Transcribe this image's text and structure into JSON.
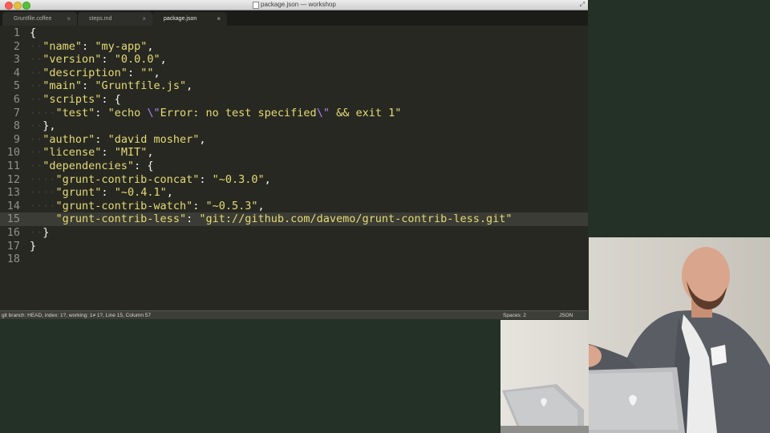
{
  "window": {
    "title": "package.json — workshop"
  },
  "tabs": [
    {
      "label": "Gruntfile.coffee",
      "active": false
    },
    {
      "label": "steps.md",
      "active": false
    },
    {
      "label": "package.json",
      "active": true
    }
  ],
  "editor": {
    "lines": [
      "{",
      "  \"name\": \"my-app\",",
      "  \"version\": \"0.0.0\",",
      "  \"description\": \"\",",
      "  \"main\": \"Gruntfile.js\",",
      "  \"scripts\": {",
      "    \"test\": \"echo \\\"Error: no test specified\\\" && exit 1\"",
      "  },",
      "  \"author\": \"david mosher\",",
      "  \"license\": \"MIT\",",
      "  \"dependencies\": {",
      "    \"grunt-contrib-concat\": \"~0.3.0\",",
      "    \"grunt\": \"~0.4.1\",",
      "    \"grunt-contrib-watch\": \"~0.5.3\",",
      "    \"grunt-contrib-less\": \"git://github.com/davemo/grunt-contrib-less.git\"",
      "  }",
      "}",
      ""
    ],
    "current_line": 15
  },
  "status": {
    "left": "git branch: HEAD, index: 1?, working: 1≠ 1?, Line 15, Column 57",
    "spaces": "Spaces: 2",
    "syntax": "JSON"
  },
  "camera": {
    "badge": "shopify"
  },
  "colors": {
    "editor_bg": "#272822",
    "string": "#e6db74",
    "escape": "#ae81ff",
    "text": "#f8f8f2",
    "backdrop": "#233127"
  }
}
